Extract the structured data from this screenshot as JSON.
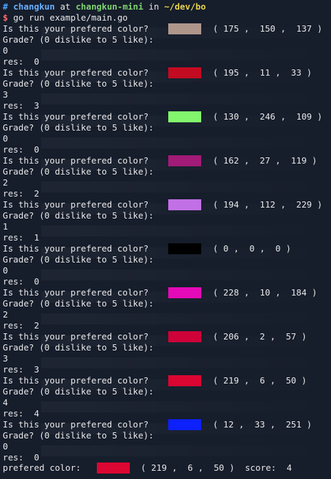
{
  "prompt": {
    "hash": "#",
    "user": "changkun",
    "at": "at",
    "host": "changkun-mini",
    "in": "in",
    "path": "~/dev/bo",
    "dollar": "$",
    "command": "go run example/main.go"
  },
  "question": "Is this your prefered color?",
  "grade_prompt": "Grade? (0 dislike to 5 like):",
  "res_label": "res:",
  "rounds": [
    {
      "color": "#af968b",
      "r": "175",
      "g": "150",
      "b": "137",
      "grade": "0",
      "res": "0"
    },
    {
      "color": "#c30b21",
      "r": "195",
      "g": "11",
      "b": "33",
      "grade": "3",
      "res": "3"
    },
    {
      "color": "#82f66d",
      "r": "130",
      "g": "246",
      "b": "109",
      "grade": "0",
      "res": "0"
    },
    {
      "color": "#a21b77",
      "r": "162",
      "g": "27",
      "b": "119",
      "grade": "2",
      "res": "2"
    },
    {
      "color": "#c270e5",
      "r": "194",
      "g": "112",
      "b": "229",
      "grade": "1",
      "res": "1"
    },
    {
      "color": "#000000",
      "r": "0",
      "g": "0",
      "b": "0",
      "grade": "0",
      "res": "0"
    },
    {
      "color": "#e40ab8",
      "r": "228",
      "g": "10",
      "b": "184",
      "grade": "2",
      "res": "2"
    },
    {
      "color": "#ce0239",
      "r": "206",
      "g": "2",
      "b": "57",
      "grade": "3",
      "res": "3"
    },
    {
      "color": "#db0632",
      "r": "219",
      "g": "6",
      "b": "50",
      "grade": "4",
      "res": "4"
    },
    {
      "color": "#0c21fb",
      "r": "12",
      "g": "33",
      "b": "251",
      "grade": "0",
      "res": "0"
    }
  ],
  "final": {
    "label": "prefered color:",
    "color": "#db0632",
    "r": "219",
    "g": "6",
    "b": "50",
    "score_label": "score:",
    "score": "4"
  }
}
